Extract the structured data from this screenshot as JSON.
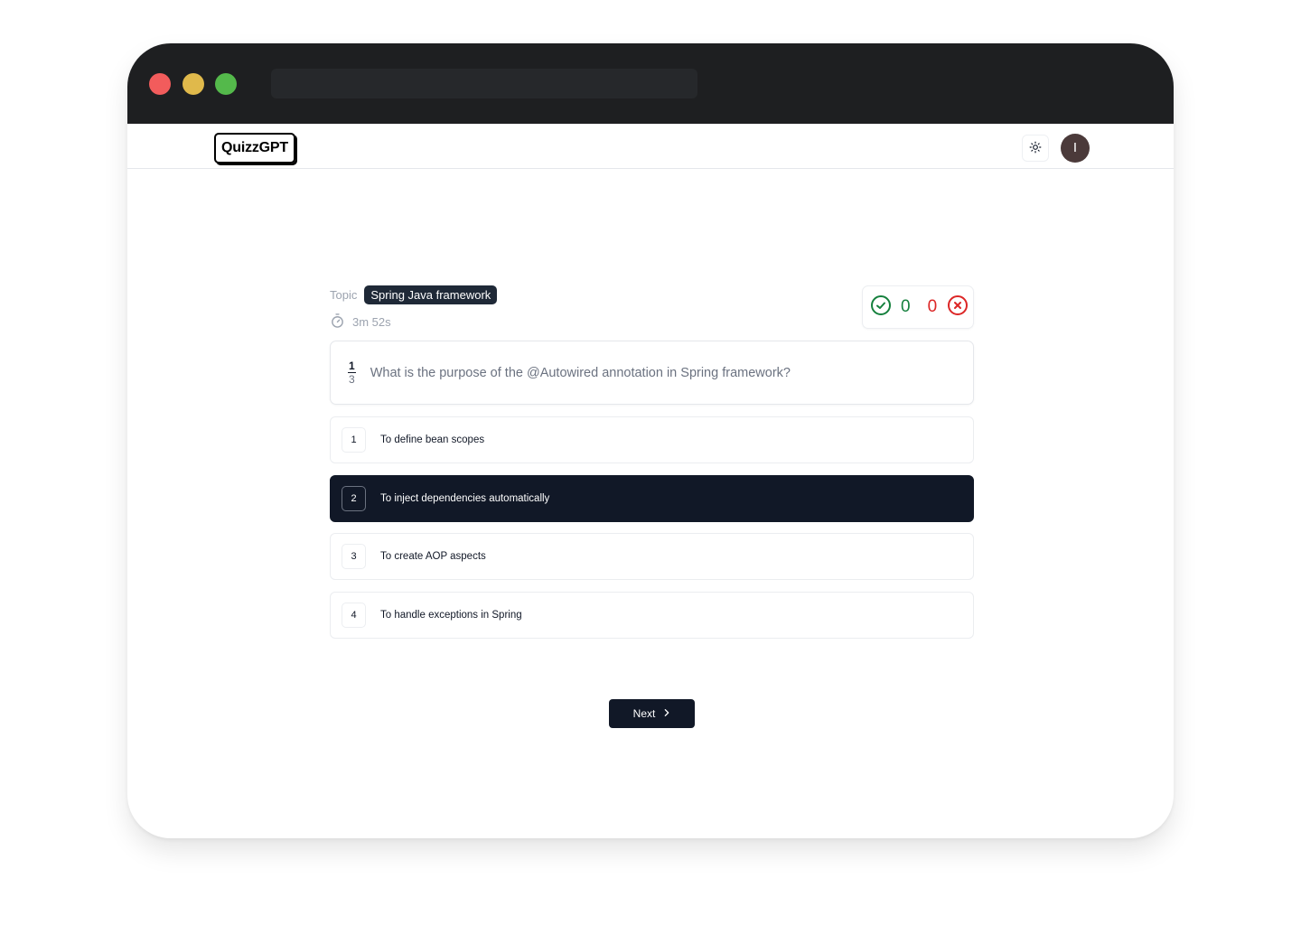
{
  "browser": {
    "url": ""
  },
  "navbar": {
    "logo": "QuizzGPT",
    "theme_toggle_icon": "sun-icon",
    "avatar_initial": "I"
  },
  "quiz": {
    "topic_label": "Topic",
    "topic": "Spring Java framework",
    "timer_icon": "stopwatch-icon",
    "elapsed": "3m 52s",
    "score": {
      "correct": "0",
      "wrong": "0",
      "correct_color": "#15803d",
      "wrong_color": "#dc2626"
    },
    "question": {
      "current": "1",
      "total": "3",
      "text": "What is the purpose of the @Autowired annotation in Spring framework?"
    },
    "options": [
      {
        "index": "1",
        "label": "To define bean scopes",
        "selected": false
      },
      {
        "index": "2",
        "label": "To inject dependencies automatically",
        "selected": true
      },
      {
        "index": "3",
        "label": "To create AOP aspects",
        "selected": false
      },
      {
        "index": "4",
        "label": "To handle exceptions in Spring",
        "selected": false
      }
    ],
    "next_label": "Next"
  }
}
